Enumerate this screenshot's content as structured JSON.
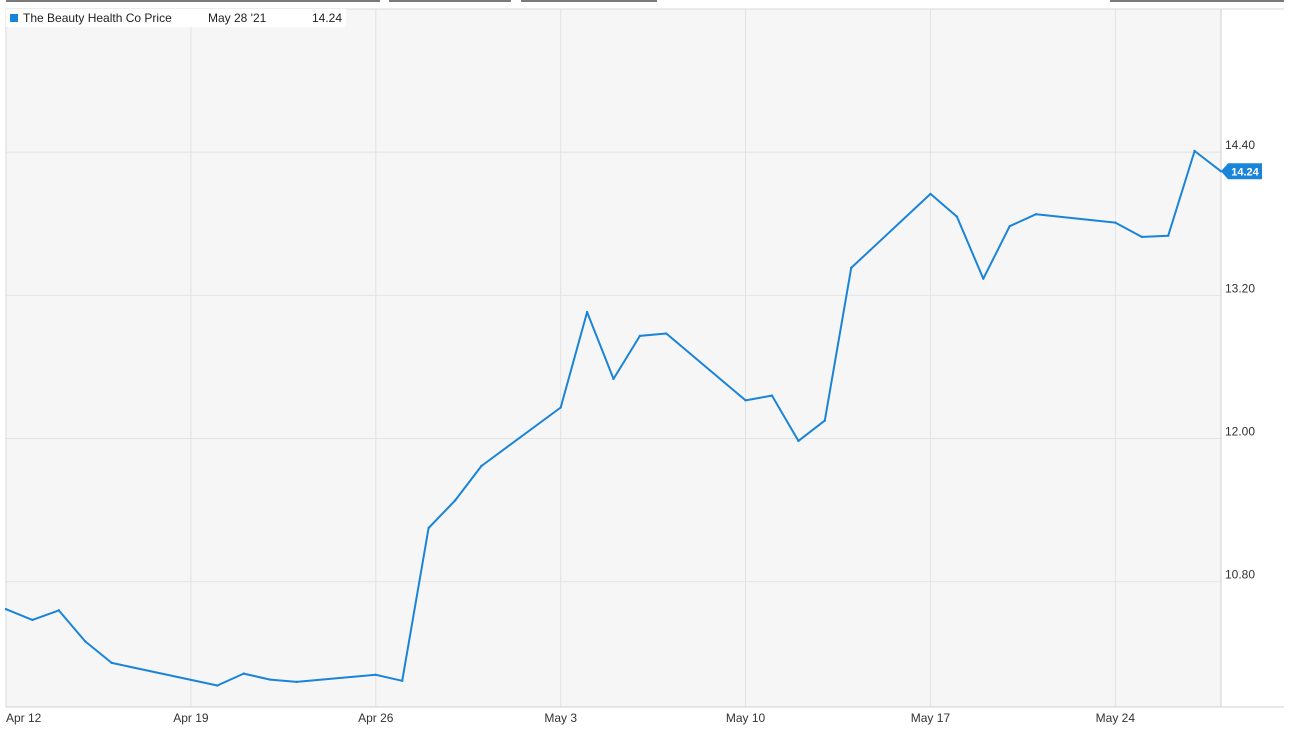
{
  "legend": {
    "series_name": "The Beauty Health Co Price",
    "date": "May 28 '21",
    "value": "14.24"
  },
  "colors": {
    "series": "#1a84d9",
    "plot_background": "#f6f6f6",
    "grid": "#e3e3e3"
  },
  "chart_data": {
    "type": "line",
    "title": "",
    "series": [
      {
        "name": "The Beauty Health Co Price",
        "x": [
          "2021-04-12",
          "2021-04-13",
          "2021-04-14",
          "2021-04-15",
          "2021-04-16",
          "2021-04-20",
          "2021-04-21",
          "2021-04-22",
          "2021-04-23",
          "2021-04-26",
          "2021-04-27",
          "2021-04-28",
          "2021-04-29",
          "2021-04-30",
          "2021-05-03",
          "2021-05-04",
          "2021-05-05",
          "2021-05-06",
          "2021-05-07",
          "2021-05-10",
          "2021-05-11",
          "2021-05-12",
          "2021-05-13",
          "2021-05-14",
          "2021-05-17",
          "2021-05-18",
          "2021-05-19",
          "2021-05-20",
          "2021-05-21",
          "2021-05-24",
          "2021-05-25",
          "2021-05-26",
          "2021-05-27",
          "2021-05-28"
        ],
        "values": [
          10.57,
          10.48,
          10.56,
          10.3,
          10.12,
          9.93,
          10.03,
          9.98,
          9.96,
          10.02,
          9.97,
          11.25,
          11.48,
          11.77,
          12.26,
          13.06,
          12.5,
          12.86,
          12.88,
          12.32,
          12.36,
          11.98,
          12.15,
          13.43,
          14.05,
          13.86,
          13.34,
          13.78,
          13.88,
          13.81,
          13.69,
          13.7,
          14.41,
          14.24
        ]
      }
    ],
    "last_value_label": "14.24",
    "x_ticks": [
      {
        "date": "2021-04-12",
        "label": "Apr 12"
      },
      {
        "date": "2021-04-19",
        "label": "Apr 19"
      },
      {
        "date": "2021-04-26",
        "label": "Apr 26"
      },
      {
        "date": "2021-05-03",
        "label": "May 3"
      },
      {
        "date": "2021-05-10",
        "label": "May 10"
      },
      {
        "date": "2021-05-17",
        "label": "May 17"
      },
      {
        "date": "2021-05-24",
        "label": "May 24"
      }
    ],
    "y_ticks": [
      {
        "value": 10.8,
        "label": "10.80"
      },
      {
        "value": 12.0,
        "label": "12.00"
      },
      {
        "value": 13.2,
        "label": "13.20"
      },
      {
        "value": 14.4,
        "label": "14.40"
      }
    ],
    "x_range": [
      "2021-04-12",
      "2021-05-28"
    ],
    "ylim": [
      9.75,
      15.6
    ],
    "y_axis_side": "right",
    "grid": true,
    "legend_position": "top-left"
  }
}
